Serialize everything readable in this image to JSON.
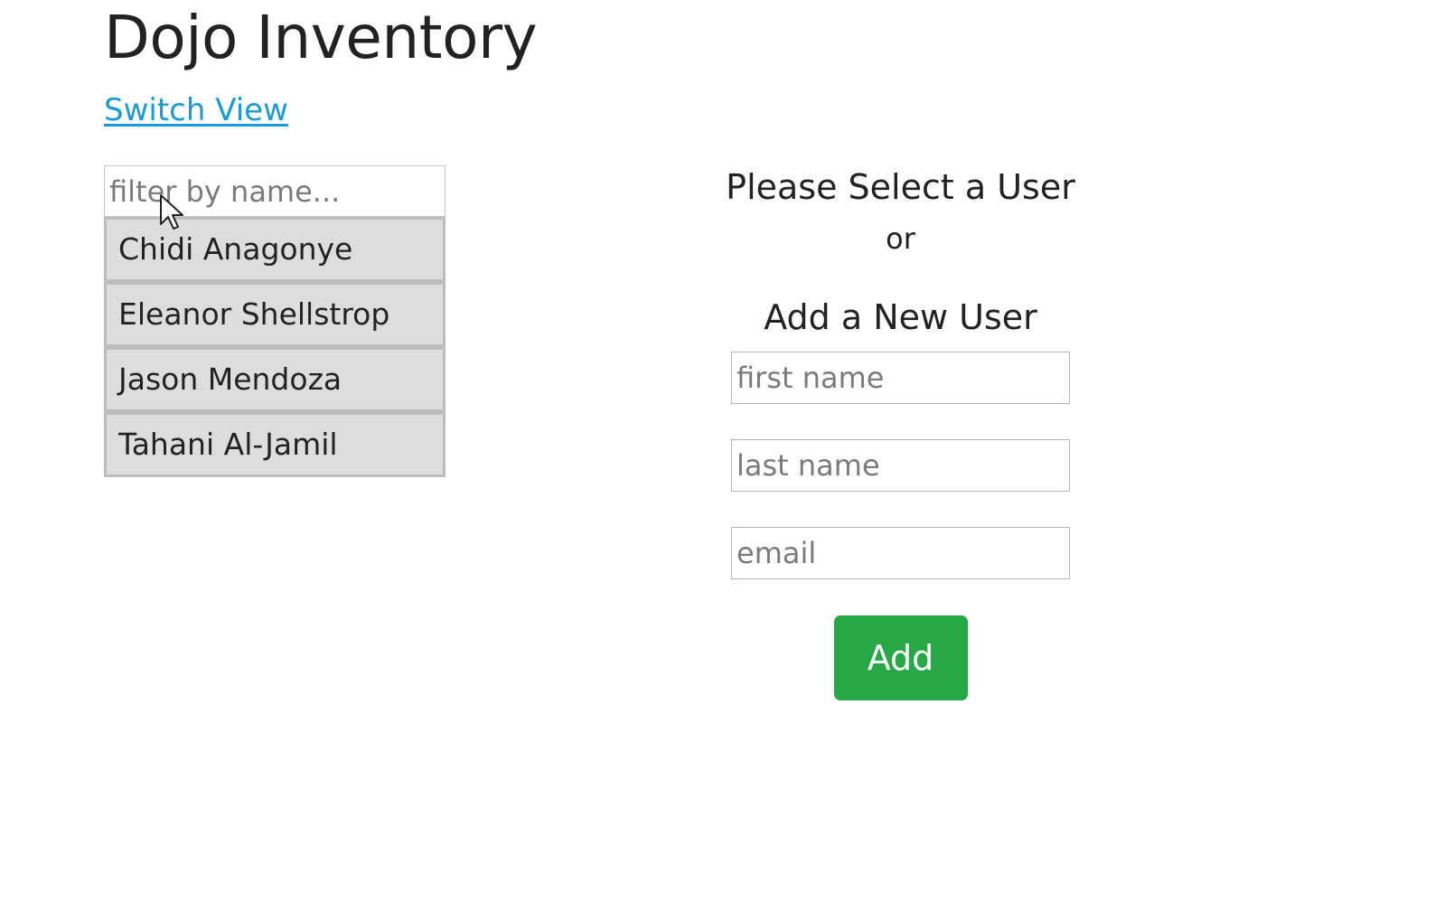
{
  "header": {
    "title": "Dojo Inventory",
    "switch_view_label": "Switch View"
  },
  "sidebar": {
    "filter_placeholder": "filter by name...",
    "filter_value": "",
    "users": [
      {
        "name": "Chidi Anagonye"
      },
      {
        "name": "Eleanor Shellstrop"
      },
      {
        "name": "Jason Mendoza"
      },
      {
        "name": "Tahani Al-Jamil"
      }
    ]
  },
  "main": {
    "select_prompt": "Please Select a User",
    "or_text": "or",
    "add_heading": "Add a New User",
    "form": {
      "first_name_placeholder": "first name",
      "last_name_placeholder": "last name",
      "email_placeholder": "email",
      "add_label": "Add"
    }
  },
  "icons": {
    "cursor": "mouse-pointer-icon"
  },
  "colors": {
    "link": "#1a9bd7",
    "button": "#27a745",
    "list_item_bg": "#dddddd"
  }
}
